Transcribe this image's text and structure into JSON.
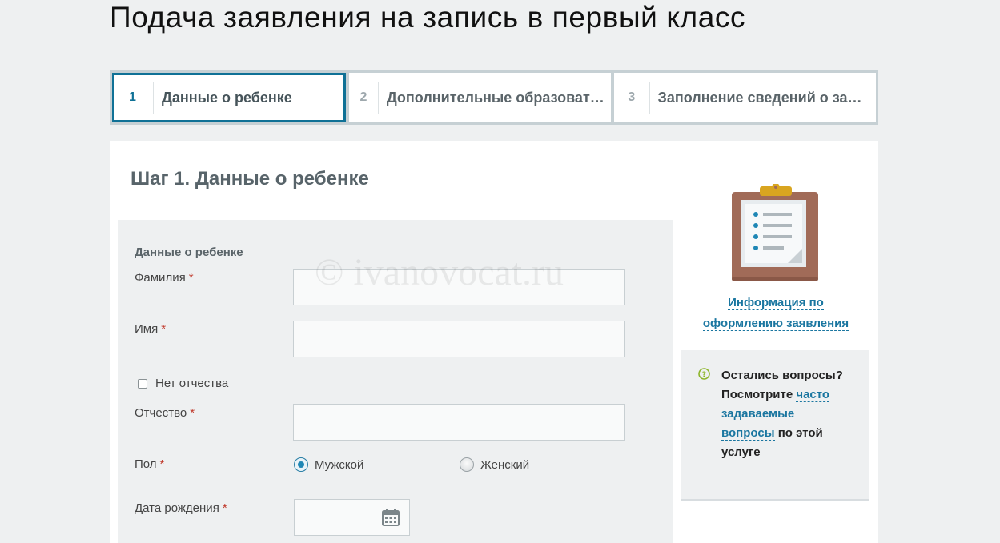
{
  "page": {
    "title": "Подача заявления на запись в первый класс"
  },
  "steps": [
    {
      "number": "1",
      "label": "Данные о ребенке",
      "active": true
    },
    {
      "number": "2",
      "label": "Дополнительные образовательные услуги",
      "active": false
    },
    {
      "number": "3",
      "label": "Заполнение сведений о заявителе",
      "active": false
    }
  ],
  "form": {
    "heading": "Шаг 1. Данные о ребенке",
    "section_label": "Данные о ребенке",
    "watermark": "© ivanovocat.ru",
    "required_mark": "*",
    "fields": {
      "surname": {
        "label": "Фамилия",
        "value": ""
      },
      "name": {
        "label": "Имя",
        "value": ""
      },
      "no_patronymic": {
        "label": "Нет отчества",
        "checked": false
      },
      "patronymic": {
        "label": "Отчество",
        "value": ""
      },
      "gender": {
        "label": "Пол",
        "options": [
          "Мужской",
          "Женский"
        ],
        "selected": "Мужской"
      },
      "birth_date": {
        "label": "Дата рождения",
        "value": ""
      }
    }
  },
  "sidebar": {
    "info_link_line1": "Информация по",
    "info_link_line2": "оформлению заявления",
    "faq": {
      "text_before": "Остались вопросы? Посмотрите ",
      "link_text": "часто задаваемые вопросы",
      "text_after": " по этой услуге"
    }
  },
  "colors": {
    "accent": "#0f7196",
    "link": "#1a76a0",
    "required": "#c0392b",
    "panel_bg": "#eef0f1",
    "help_icon": "#8db52a"
  }
}
